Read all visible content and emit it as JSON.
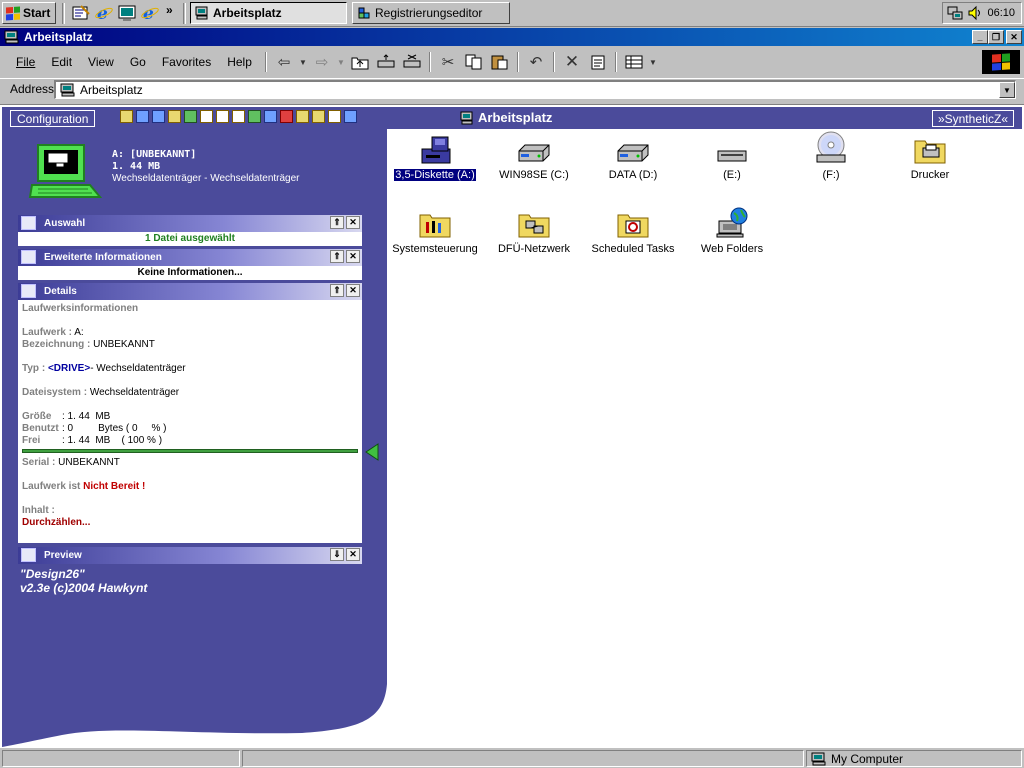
{
  "taskbar": {
    "start_label": "Start",
    "quick_launch_chevron": "»",
    "tasks": [
      {
        "label": "Arbeitsplatz",
        "active": true
      },
      {
        "label": "Registrierungseditor",
        "active": false
      }
    ],
    "clock": "06:10"
  },
  "window": {
    "title": "Arbeitsplatz",
    "minimize": "_",
    "restore": "❐",
    "close": "✕"
  },
  "menu": {
    "file": "File",
    "edit": "Edit",
    "view": "View",
    "go": "Go",
    "favorites": "Favorites",
    "help": "Help"
  },
  "address": {
    "label": "Address",
    "value": "Arbeitsplatz"
  },
  "webbar": {
    "config_label": "Configuration",
    "title": "Arbeitsplatz",
    "skin_label": "»SyntheticZ«"
  },
  "drive_info": {
    "name": "A: [UNBEKANNT]",
    "size": "1. 44 MB",
    "type": "Wechseldatenträger - Wechseldatenträger"
  },
  "sections": {
    "auswahl": {
      "title": "Auswahl",
      "text": "1 Datei ausgewählt"
    },
    "erweitert": {
      "title": "Erweiterte Informationen",
      "text": "Keine Informationen..."
    },
    "details": {
      "title": "Details"
    },
    "preview": {
      "title": "Preview"
    }
  },
  "details": {
    "heading": "Laufwerksinformationen",
    "laufwerk_label": "Laufwerk :",
    "laufwerk_value": "A:",
    "bezeichnung_label": "Bezeichnung :",
    "bezeichnung_value": "UNBEKANNT",
    "typ_label": "Typ :",
    "typ_tag": "<DRIVE>",
    "typ_value": "- Wechseldatenträger",
    "dateisystem_label": "Dateisystem :",
    "dateisystem_value": "Wechseldatenträger",
    "groesse_label": "Größe",
    "groesse_value": ": 1. 44  MB",
    "benutzt_label": "Benutzt",
    "benutzt_value": ": 0         Bytes ( 0     % )",
    "frei_label": "Frei",
    "frei_value": ": 1. 44  MB    ( 100 % )",
    "free_fraction": 1.0,
    "serial_label": "Serial :",
    "serial_value": "UNBEKANNT",
    "status_prefix": "Laufwerk ist",
    "status_value": "Nicht Bereit !",
    "inhalt_label": "Inhalt :",
    "inhalt_link": "Durchzählen..."
  },
  "preview_credit": {
    "line1": "\"Design26\"",
    "line2": "v2.3e (c)2004 Hawkynt"
  },
  "icons": [
    {
      "label": "3,5-Diskette (A:)",
      "kind": "floppy",
      "selected": true
    },
    {
      "label": "WIN98SE (C:)",
      "kind": "harddisk",
      "selected": false
    },
    {
      "label": "DATA (D:)",
      "kind": "harddisk",
      "selected": false
    },
    {
      "label": "(E:)",
      "kind": "removable",
      "selected": false
    },
    {
      "label": "(F:)",
      "kind": "cdrom",
      "selected": false
    },
    {
      "label": "Drucker",
      "kind": "printers-folder",
      "selected": false
    },
    {
      "label": "Systemsteuerung",
      "kind": "control-panel-folder",
      "selected": false
    },
    {
      "label": "DFÜ-Netzwerk",
      "kind": "dialup-folder",
      "selected": false
    },
    {
      "label": "Scheduled Tasks",
      "kind": "tasks-folder",
      "selected": false
    },
    {
      "label": "Web Folders",
      "kind": "web-folders",
      "selected": false
    }
  ],
  "statusbar": {
    "zone": "My Computer"
  },
  "colors": {
    "titlebar": "#000080",
    "panel": "#4b4b9b",
    "selection": "#000080",
    "status_red": "#c00000"
  }
}
